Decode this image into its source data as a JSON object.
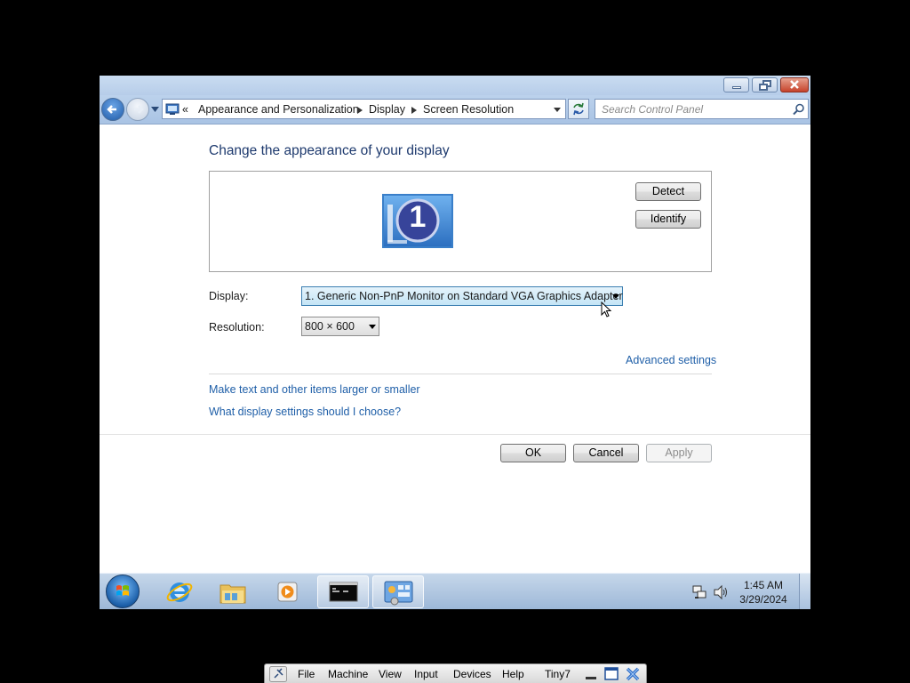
{
  "window": {
    "breadcrumb_prefix": "«",
    "breadcrumbs": [
      "Appearance and Personalization",
      "Display",
      "Screen Resolution"
    ],
    "search_placeholder": "Search Control Panel"
  },
  "content": {
    "heading": "Change the appearance of your display",
    "monitor_number": "1",
    "detect_label": "Detect",
    "identify_label": "Identify",
    "display_label": "Display:",
    "display_value": "1. Generic Non-PnP Monitor on Standard VGA Graphics Adapter",
    "resolution_label": "Resolution:",
    "resolution_value": "800 × 600",
    "advanced_link": "Advanced settings",
    "link_text_size": "Make text and other items larger or smaller",
    "link_display_help": "What display settings should I choose?",
    "ok_label": "OK",
    "cancel_label": "Cancel",
    "apply_label": "Apply"
  },
  "taskbar": {
    "time": "1:45 AM",
    "date": "3/29/2024"
  },
  "vbox": {
    "menus": [
      "File",
      "Machine",
      "View",
      "Input",
      "Devices",
      "Help"
    ],
    "vm_name": "Tiny7"
  }
}
